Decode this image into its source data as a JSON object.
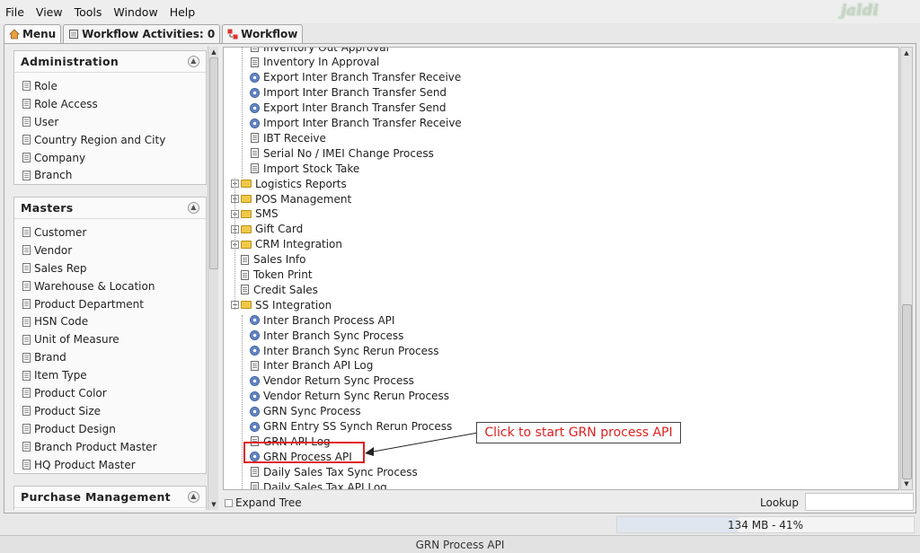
{
  "menubar": {
    "items": [
      {
        "label": "File"
      },
      {
        "label": "View"
      },
      {
        "label": "Tools"
      },
      {
        "label": "Window"
      },
      {
        "label": "Help"
      }
    ],
    "logo": "jaldi"
  },
  "tabs": [
    {
      "label": "Menu"
    },
    {
      "label": "Workflow Activities: 0"
    },
    {
      "label": "Workflow"
    }
  ],
  "sections": [
    {
      "title": "Administration",
      "items": [
        "Role",
        "Role Access",
        "User",
        "Country Region and City",
        "Company",
        "Branch"
      ]
    },
    {
      "title": "Masters",
      "items": [
        "Customer",
        "Vendor",
        "Sales Rep",
        "Warehouse & Location",
        "Product Department",
        "HSN Code",
        "Unit of Measure",
        "Brand",
        "Item Type",
        "Product Color",
        "Product Size",
        "Product Design",
        "Branch Product Master",
        "HQ Product Master"
      ]
    },
    {
      "title": "Purchase Management",
      "items": []
    }
  ],
  "tree": {
    "rows": [
      {
        "label": "Inventory Out Approval",
        "icon": "doc",
        "level": 2
      },
      {
        "label": "Inventory In Approval",
        "icon": "doc",
        "level": 2
      },
      {
        "label": "Export Inter Branch Transfer Receive",
        "icon": "gear",
        "level": 2
      },
      {
        "label": "Import Inter Branch Transfer Send",
        "icon": "gear",
        "level": 2
      },
      {
        "label": "Export Inter Branch Transfer Send",
        "icon": "gear",
        "level": 2
      },
      {
        "label": "Import Inter Branch Transfer Receive",
        "icon": "gear",
        "level": 2
      },
      {
        "label": "IBT Receive",
        "icon": "doc",
        "level": 2
      },
      {
        "label": "Serial No / IMEI Change Process",
        "icon": "doc",
        "level": 2
      },
      {
        "label": "Import Stock Take",
        "icon": "doc",
        "level": 2
      },
      {
        "label": "Logistics Reports",
        "icon": "folder",
        "level": 1
      },
      {
        "label": "POS Management",
        "icon": "folder",
        "level": 1
      },
      {
        "label": "SMS",
        "icon": "folder",
        "level": 1
      },
      {
        "label": "Gift Card",
        "icon": "folder",
        "level": 1
      },
      {
        "label": "CRM Integration",
        "icon": "folder",
        "level": 1
      },
      {
        "label": "Sales Info",
        "icon": "doc",
        "level": 1
      },
      {
        "label": "Token Print",
        "icon": "doc",
        "level": 1
      },
      {
        "label": "Credit Sales",
        "icon": "doc",
        "level": 1
      },
      {
        "label": "SS Integration",
        "icon": "folder-open",
        "level": 1
      },
      {
        "label": "Inter Branch Process API",
        "icon": "gear",
        "level": 2
      },
      {
        "label": "Inter Branch Sync Process",
        "icon": "gear",
        "level": 2
      },
      {
        "label": "Inter Branch Sync Rerun Process",
        "icon": "gear",
        "level": 2
      },
      {
        "label": "Inter Branch API Log",
        "icon": "doc",
        "level": 2
      },
      {
        "label": "Vendor Return Sync Process",
        "icon": "gear",
        "level": 2
      },
      {
        "label": "Vendor Return Sync Rerun Process",
        "icon": "gear",
        "level": 2
      },
      {
        "label": "GRN Sync Process",
        "icon": "gear",
        "level": 2
      },
      {
        "label": "GRN Entry SS Synch Rerun Process",
        "icon": "gear",
        "level": 2
      },
      {
        "label": "GRN API Log",
        "icon": "doc",
        "level": 2
      },
      {
        "label": "GRN Process API",
        "icon": "gear",
        "level": 2
      },
      {
        "label": "Daily Sales Tax Sync Process",
        "icon": "doc",
        "level": 2
      },
      {
        "label": "Daily Sales Tax API Log",
        "icon": "doc",
        "level": 2
      }
    ]
  },
  "callout": "Click to start GRN process API",
  "footer": {
    "expand_tree": "Expand Tree",
    "lookup": "Lookup",
    "memory": "134 MB - 41%",
    "memory_fraction": 0.41,
    "status": "GRN Process API"
  }
}
